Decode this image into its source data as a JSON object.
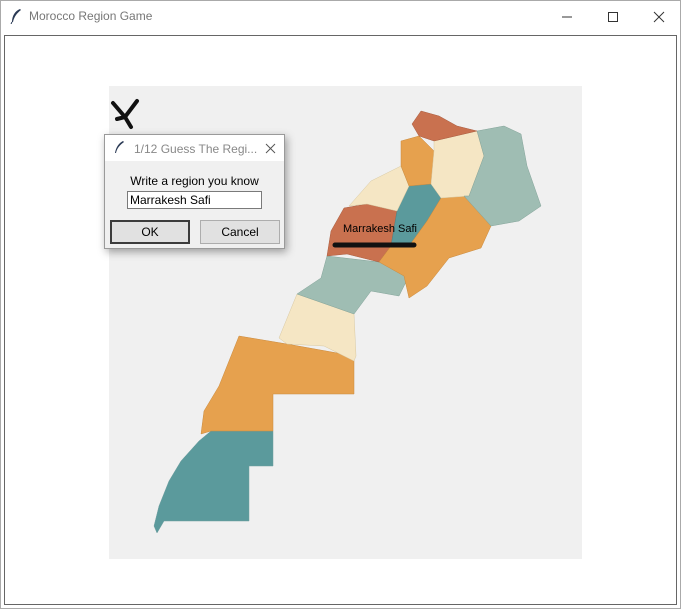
{
  "window": {
    "title": "Morocco Region Game",
    "controls": {
      "minimize": "—",
      "maximize": "☐",
      "close": "✕"
    }
  },
  "dialog": {
    "title": "1/12 Guess The Regi...",
    "close": "✕",
    "prompt": "Write a region you know",
    "input_value": "Marrakesh Safi",
    "ok_label": "OK",
    "cancel_label": "Cancel"
  },
  "map": {
    "highlighted_region_label": "Marrakesh Safi",
    "colors": {
      "terracotta": "#c9714f",
      "orange": "#e6a14e",
      "cream": "#f5e6c4",
      "sage": "#9fbdb3",
      "teal": "#5b9a9c",
      "background": "#f0f0f0"
    }
  }
}
